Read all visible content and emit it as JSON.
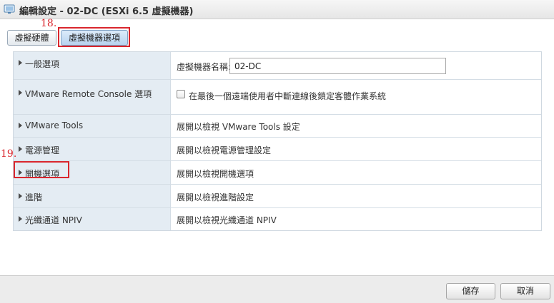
{
  "window": {
    "title": "編輯設定 - 02-DC (ESXi 6.5 虛擬機器)"
  },
  "tabs": [
    {
      "label": "虛擬硬體"
    },
    {
      "label": "虛擬機器選項"
    }
  ],
  "callouts": [
    {
      "number": "18."
    },
    {
      "number": "19."
    }
  ],
  "settings": {
    "general": {
      "label": "一般選項",
      "name_label": "虛擬機器名稱:",
      "name_value": "02-DC"
    },
    "vmrc": {
      "label": "VMware Remote Console 選項",
      "checkbox_label": "在最後一個遠端使用者中斷連線後鎖定客體作業系統",
      "checked": false
    },
    "tools": {
      "label": "VMware Tools",
      "value": "展開以檢視 VMware Tools 設定"
    },
    "power": {
      "label": "電源管理",
      "value": "展開以檢視電源管理設定"
    },
    "boot": {
      "label": "開機選項",
      "value": "展開以檢視開機選項"
    },
    "advanced": {
      "label": "進階",
      "value": "展開以檢視進階設定"
    },
    "npiv": {
      "label": "光纖通道 NPIV",
      "value": "展開以檢視光纖通道 NPIV"
    }
  },
  "footer": {
    "save_label": "儲存",
    "cancel_label": "取消"
  },
  "colors": {
    "callout": "#d9262d",
    "row_label_bg": "#e4ecf3",
    "selected_tab": "#b7d3ef"
  },
  "icons": {
    "title": "vm-icon",
    "row_expand": "caret-right-icon"
  }
}
